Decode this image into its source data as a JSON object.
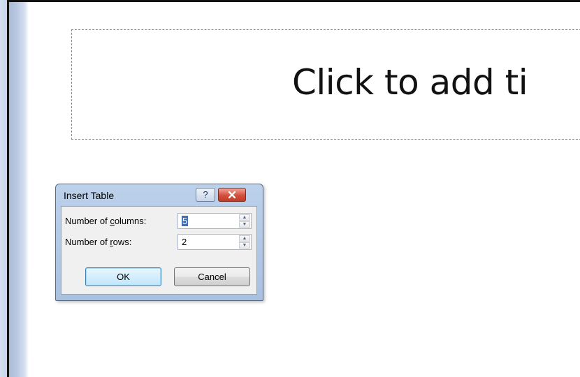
{
  "slide": {
    "title_placeholder": "Click to add ti"
  },
  "dialog": {
    "title": "Insert Table",
    "help_label": "?",
    "columns": {
      "label_before": "Number of ",
      "label_underlined": "c",
      "label_after": "olumns:",
      "value": "5"
    },
    "rows": {
      "label_before": "Number of ",
      "label_underlined": "r",
      "label_after": "ows:",
      "value": "2"
    },
    "ok_label": "OK",
    "cancel_label": "Cancel"
  }
}
